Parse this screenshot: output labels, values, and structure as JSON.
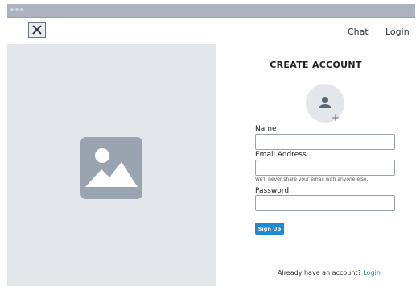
{
  "nav": {
    "links": [
      {
        "label": "Chat"
      },
      {
        "label": "Login"
      }
    ]
  },
  "icons": {
    "close": "close-icon",
    "hero": "image-placeholder-icon",
    "avatar": "user-icon",
    "avatar_add": "plus-icon"
  },
  "form": {
    "title": "CREATE ACCOUNT",
    "avatar_plus": "+",
    "name_label": "Name",
    "name_value": "",
    "email_label": "Email Address",
    "email_value": "",
    "email_hint": "We'll never share your email with anyone else.",
    "password_label": "Password",
    "password_value": "",
    "submit_label": "Sign Up"
  },
  "footer": {
    "text": "Already have an account?",
    "link_label": "Login"
  },
  "colors": {
    "accent": "#1c8ad4",
    "panel": "#e3e7ec",
    "placeholder_icon": "#9aa4b0"
  }
}
